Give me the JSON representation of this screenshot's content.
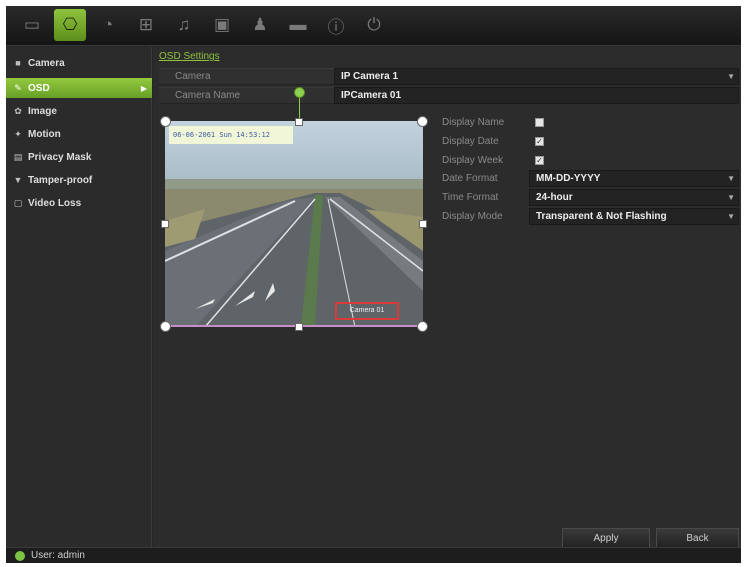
{
  "toolbar": {
    "icons": [
      "monitor-icon",
      "camera-icon",
      "record-icon",
      "network-icon",
      "alarm-icon",
      "device-icon",
      "user-icon",
      "storage-icon",
      "info-icon",
      "power-icon"
    ],
    "active_index": 1
  },
  "sidebar": {
    "items": [
      {
        "label": "Camera",
        "icon": "camera-icon"
      },
      {
        "label": "OSD",
        "icon": "osd-icon",
        "active": true
      },
      {
        "label": "Image",
        "icon": "image-icon"
      },
      {
        "label": "Motion",
        "icon": "motion-icon"
      },
      {
        "label": "Privacy Mask",
        "icon": "privacy-mask-icon"
      },
      {
        "label": "Tamper-proof",
        "icon": "tamper-icon"
      },
      {
        "label": "Video Loss",
        "icon": "video-loss-icon"
      }
    ]
  },
  "main": {
    "title": "OSD Settings",
    "camera": {
      "label": "Camera",
      "value": "IP Camera 1"
    },
    "camera_name": {
      "label": "Camera Name",
      "value": "IPCamera 01"
    },
    "display_name": {
      "label": "Display Name",
      "checked": false
    },
    "display_date": {
      "label": "Display Date",
      "checked": true
    },
    "display_week": {
      "label": "Display Week",
      "checked": true
    },
    "date_format": {
      "label": "Date Format",
      "value": "MM-DD-YYYY"
    },
    "time_format": {
      "label": "Time Format",
      "value": "24-hour"
    },
    "display_mode": {
      "label": "Display Mode",
      "value": "Transparent & Not Flashing"
    },
    "preview": {
      "date_overlay": "06-06-2061 Sun 14:53:12",
      "name_overlay": "Camera 01"
    },
    "apply_label": "Apply",
    "back_label": "Back"
  },
  "status": {
    "text": "User: admin",
    "dot_color": "#7cc242"
  },
  "colors": {
    "accent": "#8fc33e",
    "background": "#262626"
  }
}
